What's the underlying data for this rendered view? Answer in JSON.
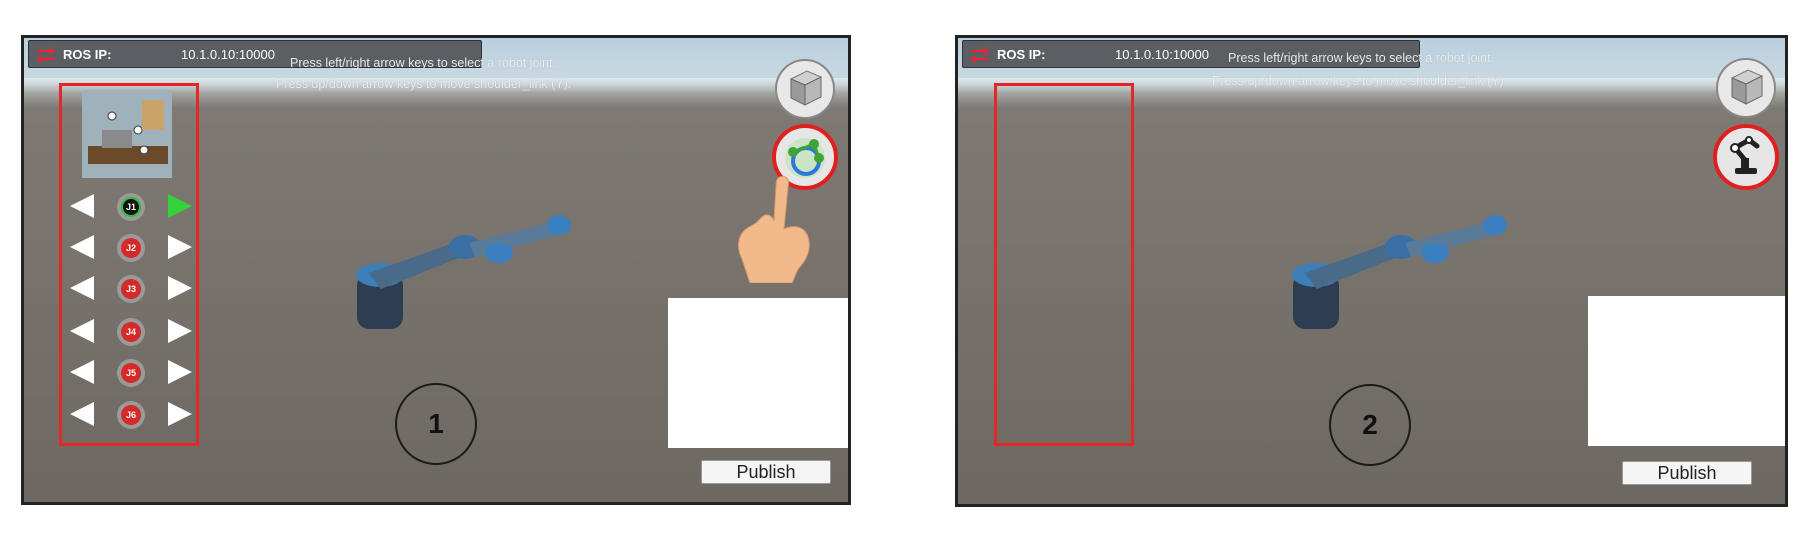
{
  "panels": [
    {
      "ros_label": "ROS IP:",
      "ros_value": "10.1.0.10:10000",
      "hint_line1": "Press left/right arrow keys to select a robot joint.",
      "hint_line2": "Press up/down arrow keys to move shoulder_link (Y).",
      "step_number": "1",
      "publish_label": "Publish",
      "joints": [
        {
          "label": "J1",
          "active": true
        },
        {
          "label": "J2",
          "active": false
        },
        {
          "label": "J3",
          "active": false
        },
        {
          "label": "J4",
          "active": false
        },
        {
          "label": "J5",
          "active": false
        },
        {
          "label": "J6",
          "active": false
        }
      ]
    },
    {
      "ros_label": "ROS IP:",
      "ros_value": "10.1.0.10:10000",
      "hint_line1": "Press left/right arrow keys to select a robot joint.",
      "hint_line2": "Press up/down arrow keys to move shoulder_link (Y).",
      "step_number": "2",
      "publish_label": "Publish"
    }
  ],
  "colors": {
    "highlight": "#e32626",
    "active_joint_arrow": "#35d13a",
    "joint_idle": "#d42a2a"
  },
  "icons": [
    "ros-connection-icon",
    "cube-icon",
    "robot-arm-icon",
    "pointing-hand-icon",
    "arrow-left-icon",
    "arrow-right-icon"
  ]
}
